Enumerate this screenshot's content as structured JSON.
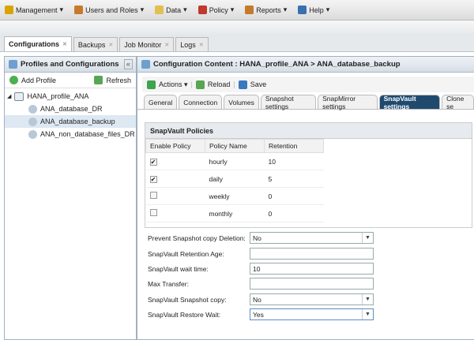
{
  "menubar": [
    {
      "label": "Management",
      "icon": "wand-icon",
      "color": "#d9a400"
    },
    {
      "label": "Users and Roles",
      "icon": "users-icon",
      "color": "#c77a2b"
    },
    {
      "label": "Data",
      "icon": "data-icon",
      "color": "#e0c050"
    },
    {
      "label": "Policy",
      "icon": "policy-icon",
      "color": "#c0392b"
    },
    {
      "label": "Reports",
      "icon": "report-icon",
      "color": "#c47a2b"
    },
    {
      "label": "Help",
      "icon": "help-icon",
      "color": "#3a6fb0"
    }
  ],
  "tabs": [
    {
      "label": "Configurations"
    },
    {
      "label": "Backups"
    },
    {
      "label": "Job Monitor"
    },
    {
      "label": "Logs"
    }
  ],
  "left": {
    "title": "Profiles and Configurations",
    "add_profile": "Add Profile",
    "refresh": "Refresh",
    "collapse": "«",
    "tree": {
      "root": "HANA_profile_ANA",
      "children": [
        "ANA_database_DR",
        "ANA_database_backup",
        "ANA_non_database_files_DR"
      ]
    }
  },
  "right": {
    "title": "Configuration Content : HANA_profile_ANA > ANA_database_backup",
    "actions": "Actions",
    "reload": "Reload",
    "save": "Save",
    "subtabs": [
      "General",
      "Connection",
      "Volumes",
      "Snapshot settings",
      "SnapMirror settings",
      "SnapVault settings",
      "Clone se"
    ]
  },
  "policies": {
    "title": "SnapVault Policies",
    "headers": [
      "Enable Policy",
      "Policy Name",
      "Retention"
    ],
    "rows": [
      {
        "enabled": true,
        "name": "hourly",
        "retention": "10"
      },
      {
        "enabled": true,
        "name": "daily",
        "retention": "5"
      },
      {
        "enabled": false,
        "name": "weekly",
        "retention": "0"
      },
      {
        "enabled": false,
        "name": "monthly",
        "retention": "0"
      }
    ]
  },
  "form": [
    {
      "label": "Prevent Snapshot copy Deletion:",
      "value": "No",
      "dropdown": true
    },
    {
      "label": "SnapVault Retention Age:",
      "value": "",
      "dropdown": false
    },
    {
      "label": "SnapVault wait time:",
      "value": "10",
      "dropdown": false
    },
    {
      "label": "Max Transfer:",
      "value": "",
      "dropdown": false
    },
    {
      "label": "SnapVault Snapshot copy:",
      "value": "No",
      "dropdown": true
    },
    {
      "label": "SnapVault Restore Wait:",
      "value": "Yes",
      "dropdown": true
    }
  ]
}
